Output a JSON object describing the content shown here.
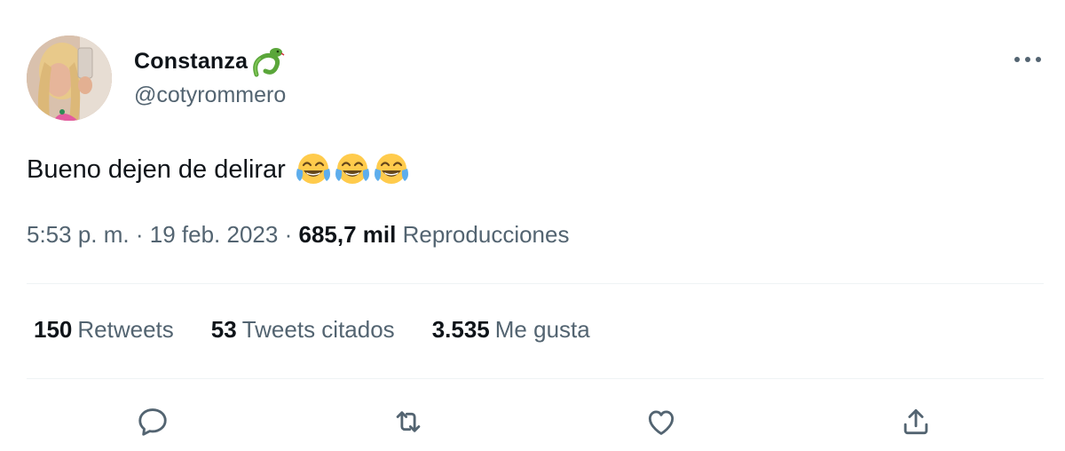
{
  "author": {
    "display_name": "Constanza",
    "handle": "@cotyrommero",
    "name_emoji": "snake-icon",
    "avatar": "profile-photo"
  },
  "tweet": {
    "text": "Bueno dejen de delirar",
    "emojis": [
      "face-with-tears-of-joy",
      "face-with-tears-of-joy",
      "face-with-tears-of-joy"
    ]
  },
  "meta": {
    "time": "5:53 p. m.",
    "separator": "·",
    "date": "19 feb. 2023",
    "views_count": "685,7 mil",
    "views_label": "Reproducciones"
  },
  "stats": [
    {
      "count": "150",
      "label": "Retweets"
    },
    {
      "count": "53",
      "label": "Tweets citados"
    },
    {
      "count": "3.535",
      "label": "Me gusta"
    }
  ],
  "actions": [
    "reply-icon",
    "retweet-icon",
    "like-icon",
    "share-icon"
  ],
  "colors": {
    "text_primary": "#0f1419",
    "text_secondary": "#536471",
    "divider": "#eff3f4"
  }
}
